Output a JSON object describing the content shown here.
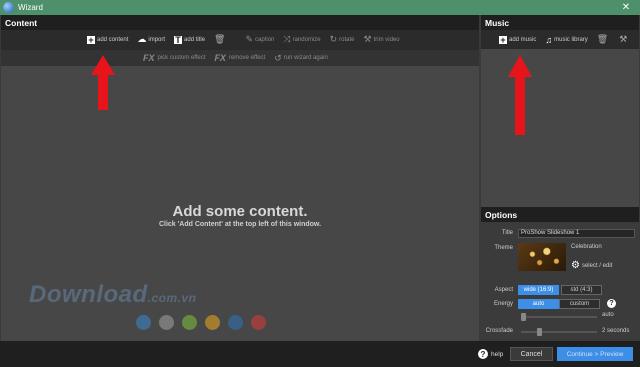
{
  "window": {
    "title": "Wizard",
    "close_glyph": "✕"
  },
  "content": {
    "header": "Content",
    "toolbar": {
      "add_content": "add content",
      "import": "import",
      "add_title": "add title",
      "caption": "caption",
      "randomize": "randomize",
      "rotate": "rotate",
      "trim_video": "trim video"
    },
    "toolbar2": {
      "pick_custom_effect": "pick custom effect",
      "remove_effect": "remove effect",
      "run_wizard_again": "run wizard again"
    },
    "empty_title": "Add some content.",
    "empty_sub": "Click 'Add Content' at the top left of this window."
  },
  "music": {
    "header": "Music",
    "add_music": "add music",
    "music_library": "music library"
  },
  "options": {
    "header": "Options",
    "title_label": "Title",
    "title_value": "ProShow Slideshow 1",
    "theme_label": "Theme",
    "theme_name": "Celebration",
    "select_edit": "select / edit",
    "aspect_label": "Aspect",
    "aspect_wide": "wide (16:9)",
    "aspect_std": "std (4:3)",
    "energy_label": "Energy",
    "energy_auto": "auto",
    "energy_custom": "custom",
    "energy_slider_value": "auto",
    "crossfade_label": "Crossfade",
    "crossfade_value": "2 seconds"
  },
  "footer": {
    "help": "help",
    "cancel": "Cancel",
    "continue": "Continue > Preview"
  },
  "watermark": {
    "main": "Download",
    "suffix": ".com.vn"
  },
  "colors": {
    "accent": "#3d8ee6",
    "arrow": "#e8141b",
    "titlebar": "#4e8f6c",
    "dots": [
      "#3b82c4",
      "#9b9b9b",
      "#7ab83c",
      "#e0a020",
      "#2f6fb0",
      "#d23a3a"
    ]
  }
}
